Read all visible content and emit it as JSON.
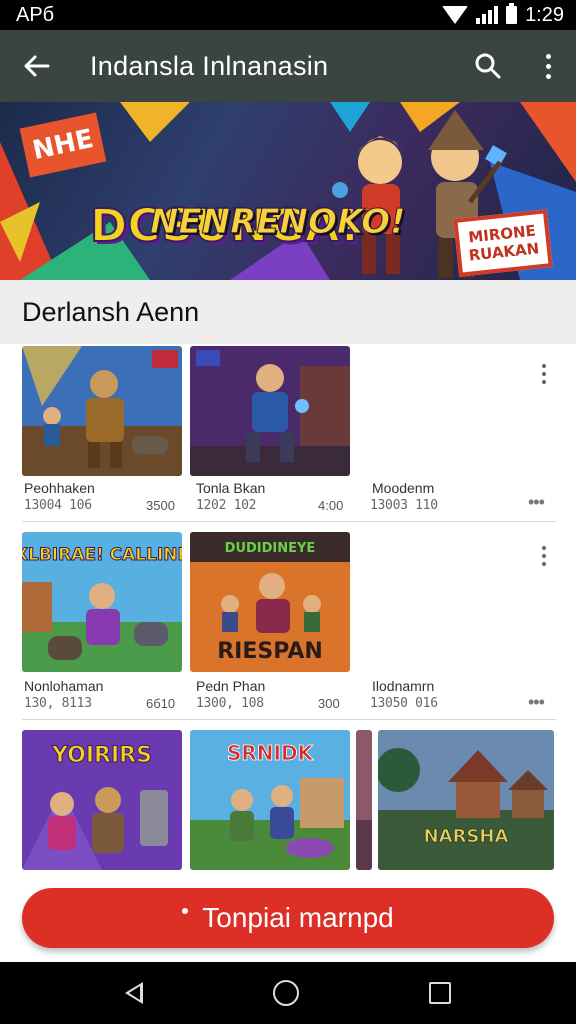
{
  "status_bar": {
    "left_text": "APб",
    "time": "1:29",
    "icons": [
      "wifi-icon",
      "signal-icon",
      "battery-icon"
    ]
  },
  "app_bar": {
    "title": "Indansla Inlnanasin",
    "back_icon": "arrow-left-icon",
    "search_icon": "search-icon",
    "menu_icon": "more-vert-icon",
    "background": "#3a4440"
  },
  "banner": {
    "badge": "NHE",
    "title": "DCSUNGA!",
    "subtitle": "NENRENOKO!",
    "cta": "MIRONE RUAKAN"
  },
  "section": {
    "title": "Derlansh Aenn"
  },
  "rows": [
    {
      "items": [
        {
          "name": "Peohhaken",
          "meta": "13004 106",
          "price": "3500"
        },
        {
          "name": "Tonla Bkan",
          "meta": "1202 102",
          "price": "4:00"
        },
        {
          "name": "Moodenm",
          "meta": "13003 110",
          "price": ""
        }
      ]
    },
    {
      "items": [
        {
          "name": "Nonlohaman",
          "meta": "130, 8113",
          "price": "6б10",
          "art_text": "XLBIRAE! CALLINE"
        },
        {
          "name": "Pedn Phan",
          "meta": "1300, 108",
          "price": "300",
          "art_text_top": "DUDIDINEYE",
          "art_text": "RIESPAN"
        },
        {
          "name": "Ilodnamrn",
          "meta": "13050 016",
          "price": ""
        }
      ]
    },
    {
      "items": [
        {
          "name": "",
          "meta": "",
          "price": "",
          "art_text": "YOIRIRS"
        },
        {
          "name": "",
          "meta": "",
          "price": "",
          "art_text": "SRNIDK"
        },
        {
          "name": "",
          "meta": "",
          "price": "",
          "art_text": "NARSHA"
        }
      ]
    }
  ],
  "cta": {
    "label": "Tonpiai marnpd",
    "color": "#dc2f26"
  },
  "nav_bar": {
    "icons": [
      "nav-back-icon",
      "nav-home-icon",
      "nav-recents-icon"
    ]
  }
}
